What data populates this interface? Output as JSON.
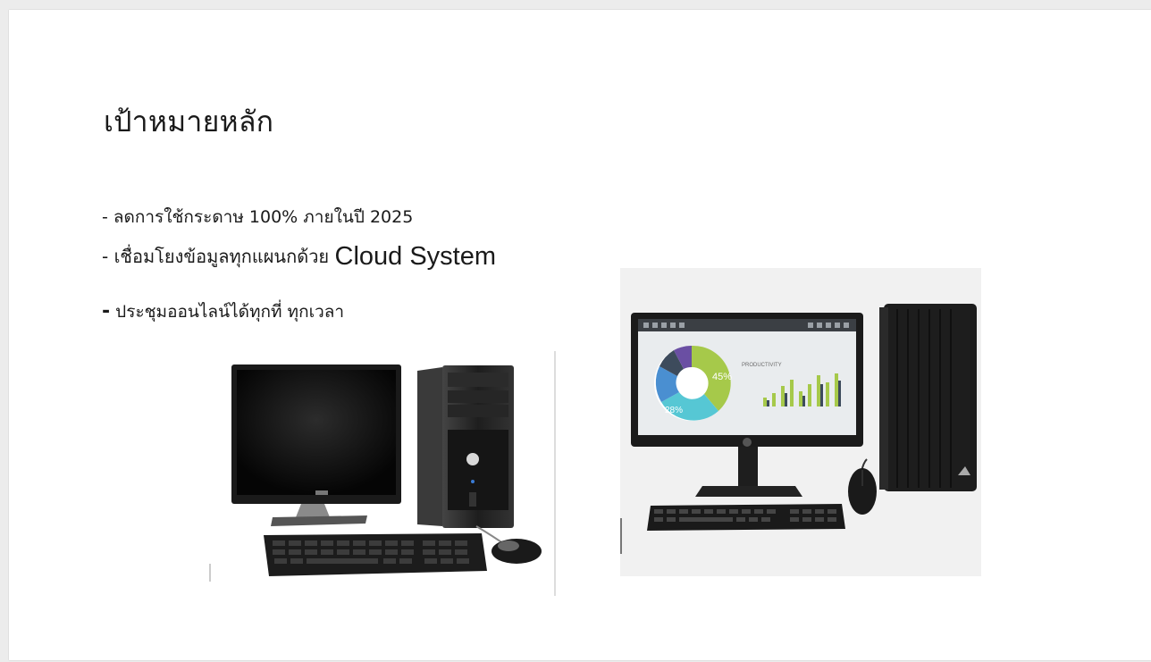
{
  "slide": {
    "title": "เป้าหมายหลัก",
    "bullets": [
      "- ลดการใช้กระดาษ 100% ภายในปี 2025",
      "- เชื่อมโยงข้อมูลทุกแผนกด้วย",
      "Cloud System",
      "-",
      " ประชุมออนไลน์ได้ทุกที่ ทุกเวลา"
    ]
  },
  "images": {
    "left_desktop": {
      "brand": "DELL"
    },
    "right_desktop": {
      "chart_labels": [
        "45%",
        "28%",
        "PRODUCTIVITY"
      ]
    }
  },
  "colors": {
    "page_background": "#ececec",
    "slide_background": "#ffffff",
    "text": "#1a1a1a"
  }
}
